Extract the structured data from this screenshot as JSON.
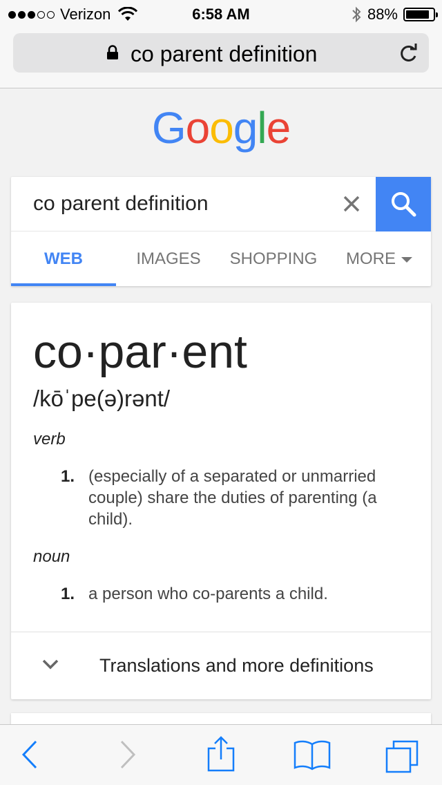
{
  "status_bar": {
    "carrier": "Verizon",
    "time": "6:58 AM",
    "battery": "88%",
    "battery_level": 0.88,
    "signal_bars_filled": 3,
    "signal_bars_total": 5
  },
  "browser": {
    "address_text": "co parent definition",
    "icons": {
      "lock": "lock-icon",
      "reload": "reload-icon"
    }
  },
  "google": {
    "logo_letters": [
      "G",
      "o",
      "o",
      "g",
      "l",
      "e"
    ],
    "logo_colors": [
      "#4285f4",
      "#ea4335",
      "#fbbc05",
      "#4285f4",
      "#34a853",
      "#ea4335"
    ],
    "search": {
      "query": "co parent definition"
    },
    "tabs": [
      {
        "label": "WEB",
        "active": true
      },
      {
        "label": "IMAGES",
        "active": false
      },
      {
        "label": "SHOPPING",
        "active": false
      },
      {
        "label": "MORE",
        "active": false
      }
    ],
    "accent_color": "#4285f4"
  },
  "definition": {
    "word": "co·par·ent",
    "phonetic": "/kōˈpe(ə)rənt/",
    "entries": [
      {
        "part_of_speech": "verb",
        "senses": [
          {
            "number": "1.",
            "text": "(especially of a separated or unmarried couple) share the duties of parenting (a child)."
          }
        ]
      },
      {
        "part_of_speech": "noun",
        "senses": [
          {
            "number": "1.",
            "text": "a person who co-parents a child."
          }
        ]
      }
    ],
    "more_label": "Translations and more definitions"
  },
  "toolbar": {
    "icons": [
      "back-icon",
      "forward-icon",
      "share-icon",
      "bookmarks-icon",
      "tabs-icon"
    ],
    "tint": "#147efb"
  }
}
